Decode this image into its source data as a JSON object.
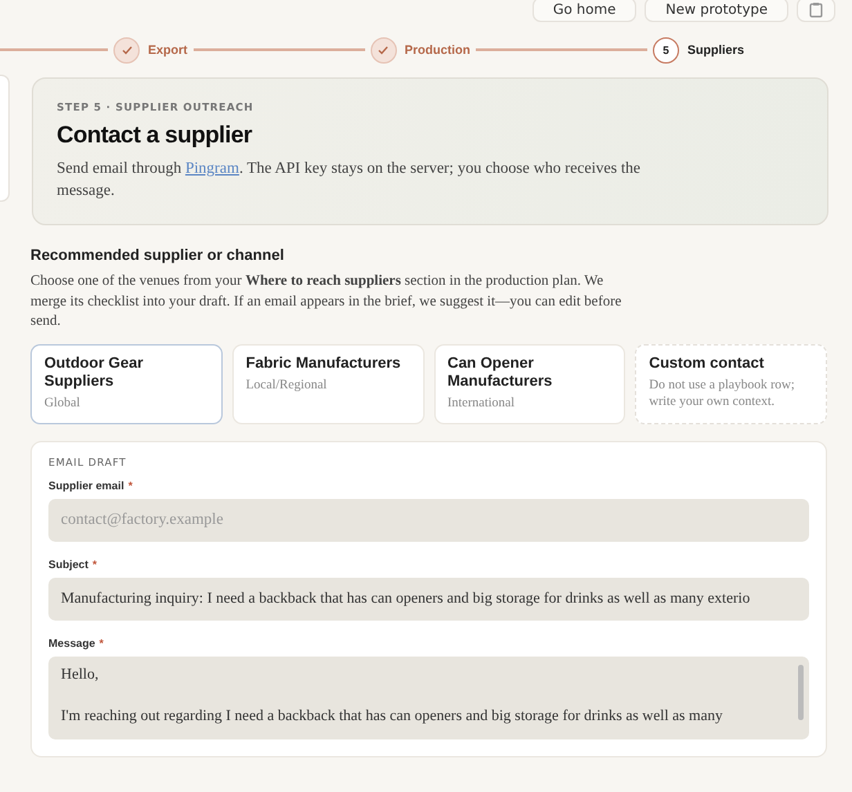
{
  "header_buttons": [
    {
      "label": "Go home",
      "kind": "text"
    },
    {
      "label": "New prototype",
      "kind": "text"
    },
    {
      "kind": "icon"
    }
  ],
  "stepper": [
    {
      "label": "Export",
      "completed": true
    },
    {
      "label": "Production",
      "completed": true
    },
    {
      "label": "Suppliers",
      "completed": false,
      "number": "5"
    }
  ],
  "hero": {
    "eyebrow": "STEP 5 · SUPPLIER OUTREACH",
    "title": "Contact a supplier",
    "text_before": "Send email through ",
    "link": "Pingram",
    "text_after": ". The API key stays on the server; you choose who receives the message."
  },
  "section": {
    "title": "Recommended supplier or channel",
    "description": "Choose one of the venues from your **Where to reach suppliers** section in the production plan. We merge its checklist into your draft. If an email appears in the brief, we suggest it—you can edit before send."
  },
  "venues": [
    {
      "kind": "venue",
      "name": "Outdoor Gear Suppliers",
      "scope": "Global",
      "selected": true
    },
    {
      "kind": "venue",
      "name": "Fabric Manufacturers",
      "scope": "Local/Regional",
      "selected": false
    },
    {
      "kind": "venue",
      "name": "Can Opener Manufacturers",
      "scope": "International",
      "selected": false
    },
    {
      "kind": "custom",
      "name": "Custom contact",
      "scope": "Do not use a playbook row; write your own context.",
      "selected": false
    }
  ],
  "email_draft": {
    "heading": "EMAIL DRAFT",
    "fields": [
      {
        "kind": "input",
        "label": "Supplier email",
        "required_mark": "*",
        "placeholder": "contact@factory.example"
      },
      {
        "kind": "input",
        "label": "Subject",
        "required_mark": "*",
        "value": "Manufacturing inquiry: I need a backback that has can openers and big storage for drinks as well as many exterio"
      },
      {
        "kind": "textarea",
        "label": "Message",
        "required_mark": "*",
        "paragraphs": [
          "Hello,",
          "I'm reaching out regarding I need a backback that has can openers and big storage for drinks as well as many"
        ]
      }
    ]
  }
}
